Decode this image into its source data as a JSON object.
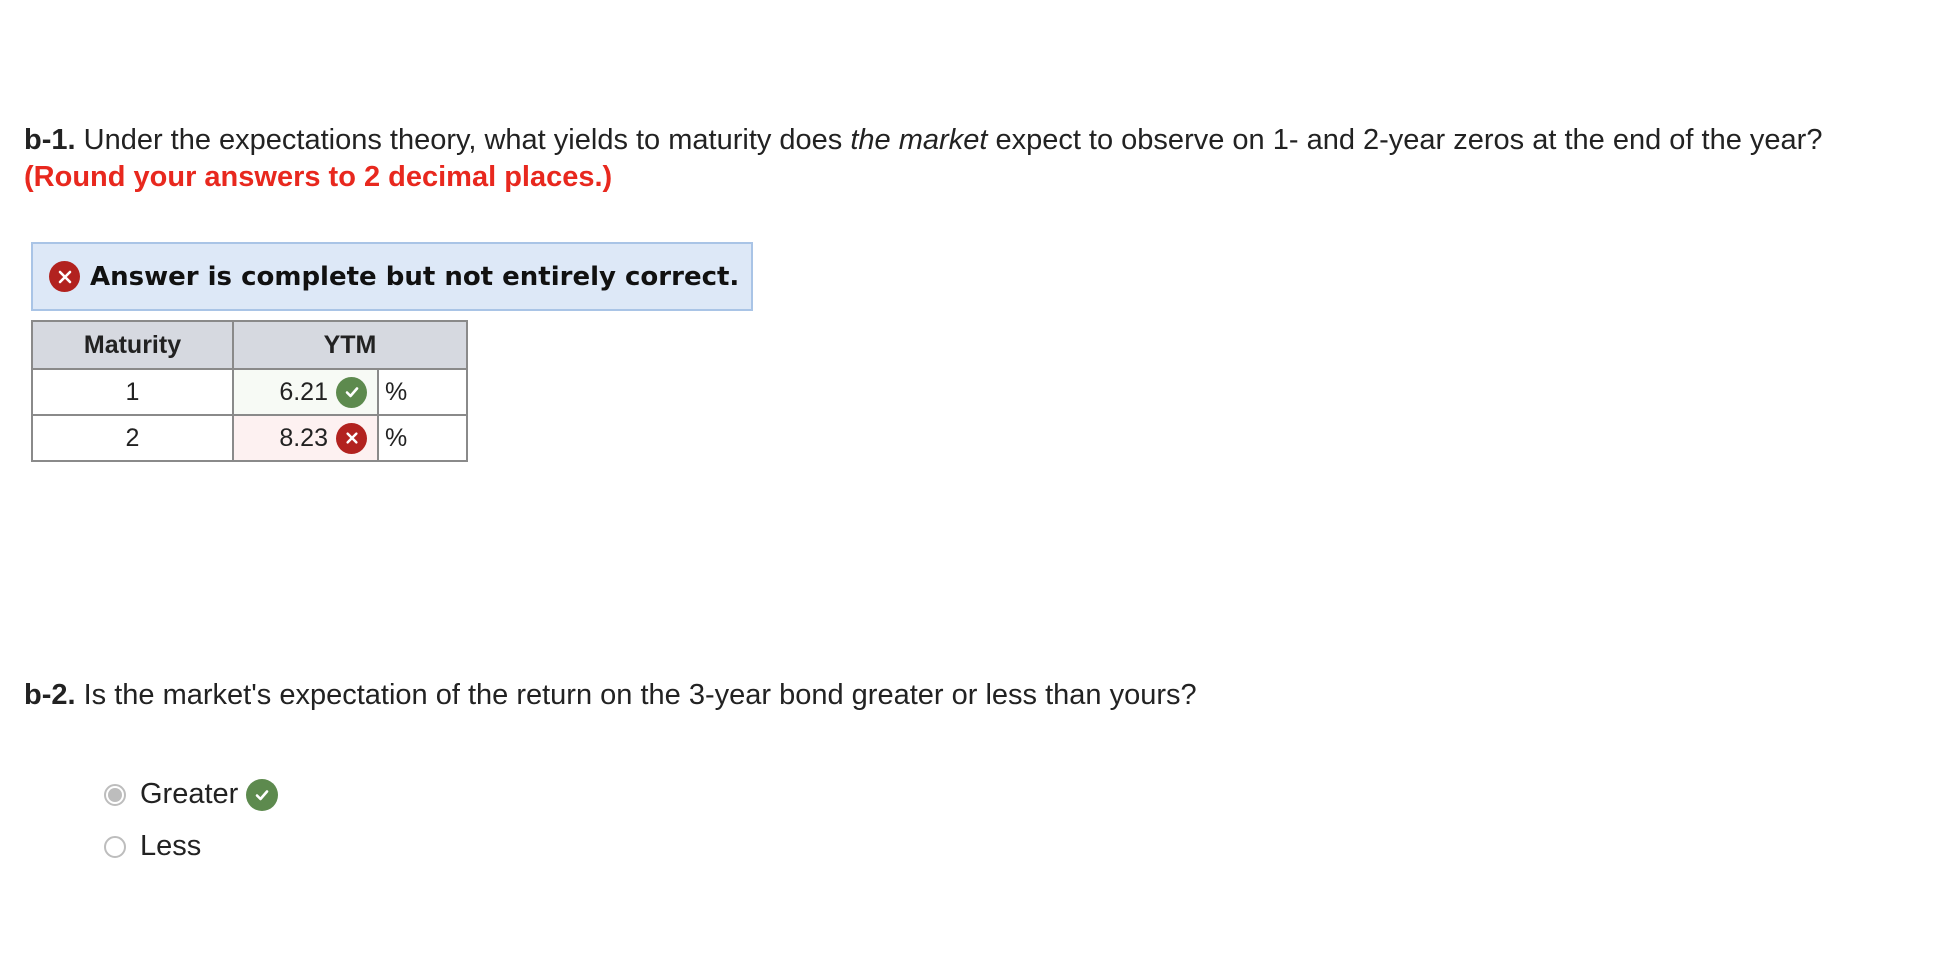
{
  "q1": {
    "label": "b-1.",
    "text_a": "Under the expectations theory, what yields to maturity does",
    "text_em": "the market",
    "text_b": "expect to observe on 1- and 2-year zeros at the end of the year?",
    "instruction": "(Round your answers to 2 decimal places.)"
  },
  "status": {
    "message": "Answer is complete but not entirely correct.",
    "icon": "x-circle-icon",
    "color": "#b2221f"
  },
  "table": {
    "headers": [
      "Maturity",
      "YTM"
    ],
    "rows": [
      {
        "maturity": "1",
        "ytm": "6.21",
        "unit": "%",
        "result": "correct"
      },
      {
        "maturity": "2",
        "ytm": "8.23",
        "unit": "%",
        "result": "incorrect"
      }
    ]
  },
  "q2": {
    "label": "b-2.",
    "text": "Is the market's expectation of the return on the 3-year bond greater or less than yours?",
    "options": [
      {
        "label": "Greater",
        "selected": true,
        "result": "correct"
      },
      {
        "label": "Less",
        "selected": false
      }
    ]
  },
  "colors": {
    "correct": "#5d8a4e",
    "incorrect": "#b2221f",
    "instruction": "#e8281e",
    "status_bg": "#dde8f7"
  }
}
